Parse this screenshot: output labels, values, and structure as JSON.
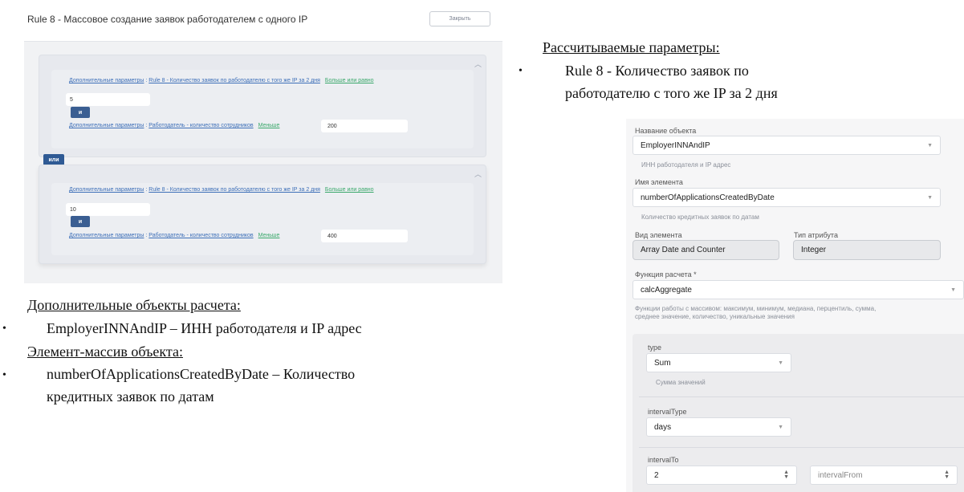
{
  "rule_builder": {
    "title": "Rule 8 - Массовое создание заявок работодателем с одного IP",
    "close_label": "Закрыть",
    "or_label": "или",
    "groups": [
      {
        "conditions": [
          {
            "prefix": "Дополнительные параметры",
            "sep": " : ",
            "param": "Rule 8 - Количество заявок по работодателю с того же IP за 2 дня",
            "operator": "Больше или равно",
            "value": "5"
          },
          {
            "prefix": "Дополнительные параметры",
            "sep": " : ",
            "param": "Работодатель - количество сотрудников",
            "operator": "Меньше",
            "value": "200"
          }
        ],
        "and_label": "и"
      },
      {
        "conditions": [
          {
            "prefix": "Дополнительные параметры",
            "sep": " : ",
            "param": "Rule 8 - Количество заявок по работодателю с того же IP за 2 дня",
            "operator": "Больше или равно",
            "value": "10"
          },
          {
            "prefix": "Дополнительные параметры",
            "sep": " : ",
            "param": "Работодатель - количество сотрудников",
            "operator": "Меньше",
            "value": "400"
          }
        ],
        "and_label": "и"
      }
    ]
  },
  "doc": {
    "additional_objects_heading": "Дополнительные объекты расчета:",
    "additional_objects_bullet": "EmployerINNAndIP – ИНН работодателя и IP адрес",
    "array_element_heading": "Элемент-массив объекта:",
    "array_element_bullet_line1": "numberOfApplicationsCreatedByDate – Количество",
    "array_element_bullet_line2": "кредитных заявок по датам",
    "calc_params_heading": "Рассчитываемые параметры:",
    "calc_params_bullet_line1": "Rule 8 - Количество заявок по",
    "calc_params_bullet_line2": "работодателю с того же IP за 2 дня",
    "bullet_char": "•"
  },
  "form": {
    "object_name_label": "Название объекта",
    "object_name_value": "EmployerINNAndIP",
    "object_name_hint": "ИНН работодателя и IP адрес",
    "element_name_label": "Имя элемента",
    "element_name_value": "numberOfApplicationsCreatedByDate",
    "element_name_hint": "Количество кредитных заявок по датам",
    "element_kind_label": "Вид элемента",
    "element_kind_value": "Array Date and Counter",
    "attr_type_label": "Тип атрибута",
    "attr_type_value": "Integer",
    "calc_function_label": "Функция расчета *",
    "calc_function_value": "calcAggregate",
    "calc_function_hint_line1": "Функции работы с массивом: максимум, минимум, медиана, перцентиль, сумма,",
    "calc_function_hint_line2": "среднее значение, количество, уникальные значения",
    "type_label": "type",
    "type_value": "Sum",
    "type_hint": "Сумма значений",
    "interval_type_label": "intervalType",
    "interval_type_value": "days",
    "interval_to_label": "intervalTo",
    "interval_to_value": "2",
    "interval_from_placeholder": "intervalFrom"
  }
}
